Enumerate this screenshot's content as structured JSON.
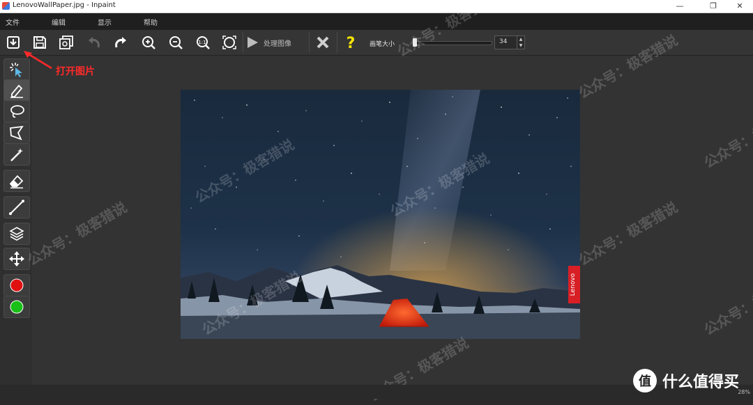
{
  "window": {
    "title": "LenovoWallPaper.jpg - Inpaint"
  },
  "menu": [
    "文件",
    "编辑",
    "显示",
    "帮助"
  ],
  "toolbar": {
    "process_label": "处理图像",
    "brush_size_label": "画笔大小",
    "brush_size_value": "34",
    "brush_size_fraction": 0.03
  },
  "annotation": {
    "text": "打开图片"
  },
  "photo": {
    "brand_label": "Lenovo"
  },
  "watermark": {
    "text": "公众号：极客猎说"
  },
  "brand": {
    "logo_glyph": "值",
    "text": "什么值得买"
  },
  "status": {
    "zoom": "28%"
  },
  "colors": {
    "tool_red": "#e01010",
    "tool_green": "#18c018",
    "annotation_red": "#ff2a2a",
    "help_yellow": "#f5e500"
  }
}
